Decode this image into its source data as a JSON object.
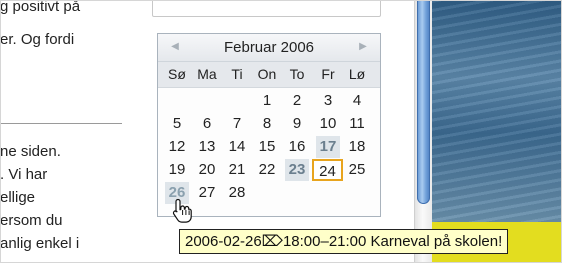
{
  "page": {
    "lines": [
      "g positivt på",
      "er. Og fordi",
      "ne siden.",
      ". Vi har",
      "ellige",
      "ersom du",
      "anlig enkel i"
    ]
  },
  "calendar": {
    "prev_icon": "chevron-left-icon",
    "next_icon": "chevron-right-icon",
    "prev_glyph": "◀",
    "next_glyph": "▶",
    "month_title": "Februar 2006",
    "weekdays": [
      "Sø",
      "Ma",
      "Ti",
      "On",
      "To",
      "Fr",
      "Lø"
    ],
    "weeks": [
      [
        "",
        "",
        "",
        "1",
        "2",
        "3",
        "4"
      ],
      [
        "5",
        "6",
        "7",
        "8",
        "9",
        "10",
        "11"
      ],
      [
        "12",
        "13",
        "14",
        "15",
        "16",
        "17",
        "18"
      ],
      [
        "19",
        "20",
        "21",
        "22",
        "23",
        "24",
        "25"
      ],
      [
        "26",
        "27",
        "28",
        "",
        "",
        "",
        ""
      ]
    ],
    "event_days": [
      "17",
      "23",
      "26"
    ],
    "today": "24",
    "hover_day": "26",
    "colors": {
      "today_border": "#e8a41d",
      "event_bg": "#dfe5ea"
    }
  },
  "tooltip": {
    "text": "2006-02-26⌦18:00–21:00 Karneval på skolen!"
  },
  "cursor": {
    "icon": "pointing-hand-cursor-icon"
  }
}
